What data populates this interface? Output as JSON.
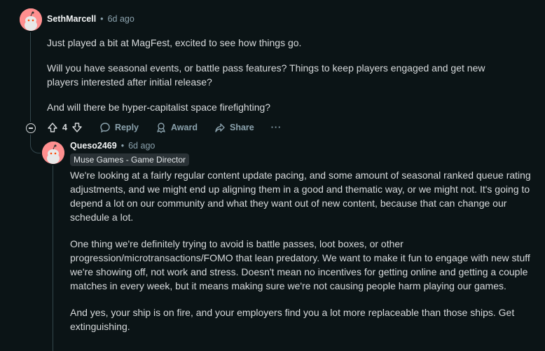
{
  "comment": {
    "username": "SethMarcell",
    "time": "6d ago",
    "paragraphs": [
      "Just played a bit at MagFest, excited to see how things go.",
      "Will you have seasonal events, or battle pass features? Things to keep players engaged and get new players interested after initial release?",
      "And will there be hyper-capitalist space firefighting?"
    ],
    "score": "4",
    "actions": {
      "reply": "Reply",
      "award": "Award",
      "share": "Share",
      "more": "···"
    }
  },
  "reply": {
    "username": "Queso2469",
    "time": "6d ago",
    "flair": "Muse Games - Game Director",
    "paragraphs": [
      "We're looking at a fairly regular content update pacing, and some amount of seasonal ranked queue rating adjustments, and we might end up aligning them in a good and thematic way, or we might not. It's going to depend a lot on our community and what they want out of new content, because that can change our schedule a lot.",
      "One thing we're definitely trying to avoid is battle passes, loot boxes, or other progression/microtransactions/FOMO that lean predatory. We want to make it fun to engage with new stuff we're showing off, not work and stress. Doesn't mean no incentives for getting online and getting a couple matches in every week, but it means making sure we're not causing people harm playing our games.",
      "And yes, your ship is on fire, and your employers find you a lot more replaceable than those ships. Get extinguishing."
    ]
  },
  "icons": {
    "upvote": "upvote-icon",
    "downvote": "downvote-icon",
    "reply": "comment-bubble-icon",
    "award": "award-ribbon-icon",
    "share": "share-arrow-icon",
    "collapse": "collapse-minus-icon"
  }
}
